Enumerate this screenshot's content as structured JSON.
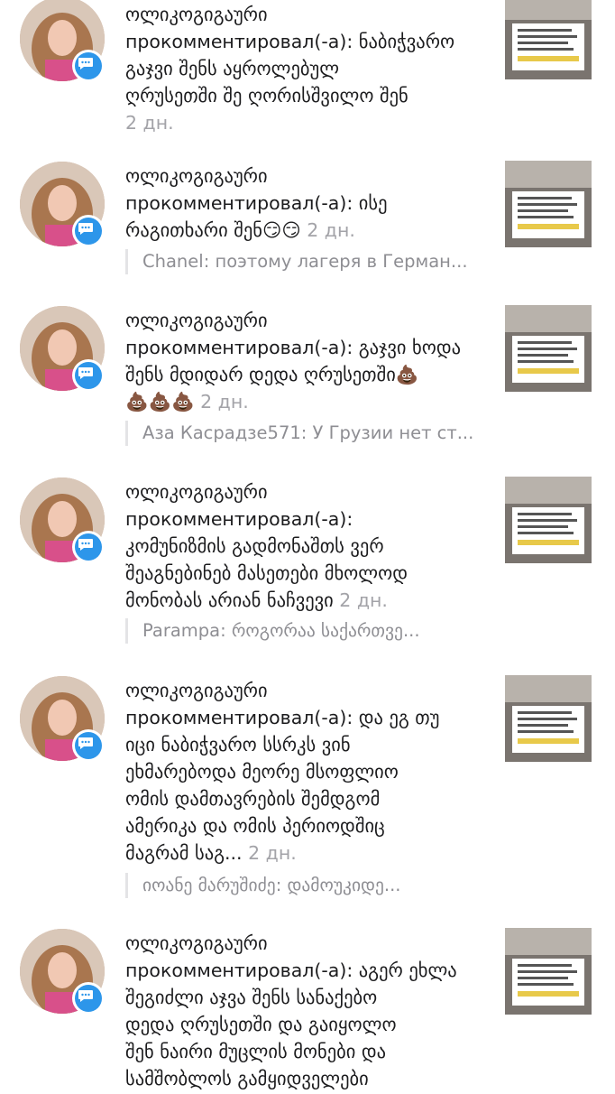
{
  "notifications": [
    {
      "username": "ოლიკოგიგაური",
      "lines": [
        "прокомментировал(-а): ნაბიჭვარო",
        "გაჯვი შენს აყროლებულ",
        "ღრუსეთში შე ღორისშვილო შენ"
      ],
      "time": "2 дн.",
      "reply": ""
    },
    {
      "username": "ოლიკოგიგაური",
      "lines": [
        "прокомментировал(-а): ისე",
        "რაგითხარი შენ😏😏"
      ],
      "time": "2 дн.",
      "reply": "Chanel: поэтому лагеря в Герман..."
    },
    {
      "username": "ოლიკოგიგაური",
      "lines": [
        "прокомментировал(-а): გაჯვი ხოდა",
        "შენს მდიდარ დედა ღრუსეთში💩",
        "💩💩💩"
      ],
      "time": "2 дн.",
      "reply": "Аза Касрадзе571: У Грузии нет ст..."
    },
    {
      "username": "ოლიკოგიგაური",
      "lines": [
        "прокомментировал(-а):",
        "კომუნიზმის გადმონაშთს ვერ",
        "შეაგნებინებ მასეთები მხოლოდ",
        "მონობას არიან ნაჩვევი"
      ],
      "time": "2 дн.",
      "reply": "Parampa: როგორაა საქართვე..."
    },
    {
      "username": "ოლიკოგიგაური",
      "lines": [
        "прокомментировал(-а): და ეგ თუ",
        "იცი ნაბიჭვარო სსრკს ვინ",
        "ეხმარებოდა მეორე მსოფლიო",
        "ომის დამთავრების შემდგომ",
        "ამერიკა და ომის პერიოდშიც",
        "მაგრამ საგ..."
      ],
      "time": "2 дн.",
      "reply": "იოანე მარუშიძე: დამოუკიდე..."
    },
    {
      "username": "ოლიკოგიგაური",
      "lines": [
        "прокомментировал(-а): აგერ ეხლა",
        "შეგიძლი აჯვა შენს სანაქებო",
        "დედა ღრუსეთში და გაიყოლო",
        "შენ ნაირი მუცლის მონები და",
        "სამშობლოს გამყიდველები"
      ],
      "time": "",
      "reply": ""
    }
  ],
  "icons": {
    "badge": "comment-bubble-icon",
    "avatar": "profile-photo",
    "thumbnail": "post-thumbnail"
  },
  "colors": {
    "badge": "#2d96ea",
    "time": "#a3a3a8",
    "reply": "#8e8e93"
  }
}
